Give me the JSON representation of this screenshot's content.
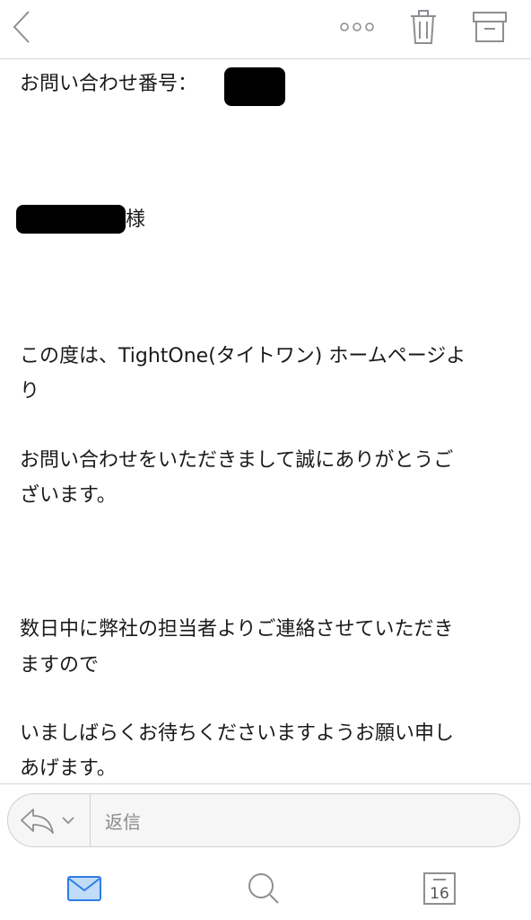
{
  "toolbar": {
    "back_icon": "chevron-left-icon",
    "more_icon": "more-icon",
    "trash_icon": "trash-icon",
    "archive_icon": "archive-icon"
  },
  "message": {
    "inquiry_label": "お問い合わせ番号：",
    "recipient_suffix": "様",
    "body_lines": [
      "この度は、TightOne(タイトワン) ホームページよ",
      "り",
      "お問い合わせをいただきまして誠にありがとうご",
      "ざいます。",
      "数日中に弊社の担当者よりご連絡させていただき",
      "ますので",
      "いましばらくお待ちくださいますようお願い申し",
      "あげます。"
    ]
  },
  "reply": {
    "placeholder": "返信"
  },
  "tabbar": {
    "calendar_day": "16"
  },
  "colors": {
    "accent": "#2f7ce6",
    "icon_gray": "#8e8e93",
    "redaction": "#000000"
  }
}
